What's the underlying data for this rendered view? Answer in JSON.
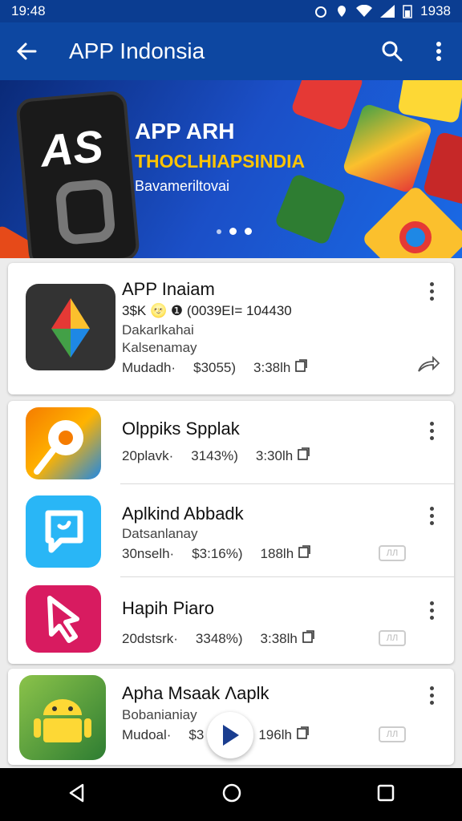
{
  "status": {
    "time": "19:48",
    "right_text": "1938"
  },
  "appbar": {
    "title": "APP Indonsia"
  },
  "banner": {
    "title": "APP ARH",
    "subtitle": "THOCLHIAPSINDIA",
    "small": "Bavameriltovai",
    "logo_text": "AS"
  },
  "featured": {
    "name": "APP Inaiam",
    "line1": "3$K 🌝 ❶ (0039EI= 104430",
    "line2": "Dakarlkahai",
    "line3": "Kalsenamay",
    "meta": [
      "Mudadh·",
      "$3055)",
      "3:38lh"
    ]
  },
  "apps": [
    {
      "name": "Olppiks Spplak",
      "sub": "",
      "meta": [
        "20plavk·",
        "3143%)",
        "3:30lh"
      ],
      "badge": ""
    },
    {
      "name": "Aplkind Abbadk",
      "sub": "Datsanlanay",
      "meta": [
        "30nselh·",
        "$3:16%)",
        "188lh"
      ],
      "badge": "ЛЛ"
    },
    {
      "name": "Hapih Piaro",
      "sub": "",
      "meta": [
        "20dstsrk·",
        "3348%)",
        "3:38lh"
      ],
      "badge": "ЛЛ"
    },
    {
      "name": "Apha Msaak Λaplk",
      "sub": "Bobanianiay",
      "meta": [
        "Mudoal·",
        "$3",
        "196lh"
      ],
      "badge": "ЛЛ"
    }
  ],
  "icons": {
    "back": "arrow-left-icon",
    "search": "search-icon",
    "more": "more-vert-icon",
    "share": "share-icon",
    "copy": "copy-icon",
    "play": "play-icon"
  },
  "colors": {
    "primary": "#0d47a1",
    "accent": "#ffc400"
  }
}
